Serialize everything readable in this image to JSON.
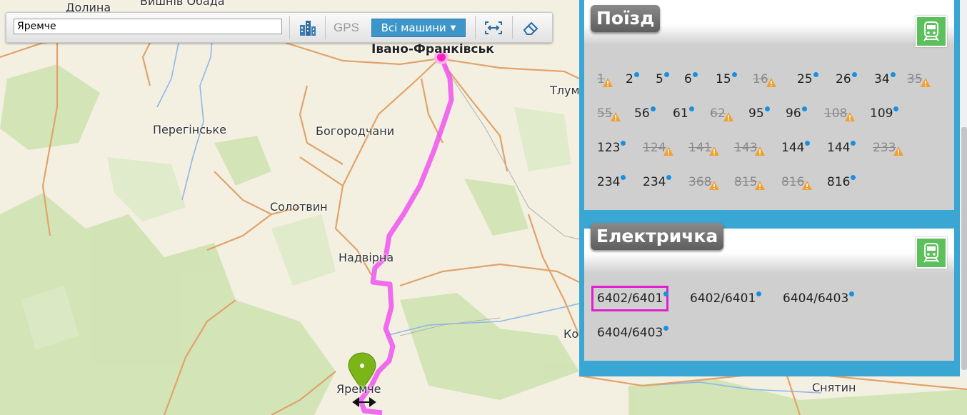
{
  "toolbar": {
    "search_value": "Яремче",
    "gps_label": "GPS",
    "machines_label": "Всі машини"
  },
  "map": {
    "labels": {
      "dolyna": "Долина",
      "vyshniv": "Вишнів Обада",
      "ivano": "Івано-Франківськ",
      "tlum": "Тлум",
      "perehinske": "Перегінське",
      "bohorodchany": "Богородчани",
      "solotvyn": "Солотвин",
      "nadvirna": "Надвірна",
      "yaremche": "Яремче",
      "ko": "Ко",
      "sniatyn": "Снятин"
    }
  },
  "panel": {
    "train": {
      "title": "Поїзд",
      "rows": [
        [
          {
            "num": "1",
            "ok": false
          },
          {
            "num": "2",
            "ok": true
          },
          {
            "num": "5",
            "ok": true
          },
          {
            "num": "6",
            "ok": true
          },
          {
            "num": "15",
            "ok": true
          },
          {
            "num": "16",
            "ok": false
          },
          {
            "num": "25",
            "ok": true
          },
          {
            "num": "26",
            "ok": true
          },
          {
            "num": "34",
            "ok": true
          },
          {
            "num": "35",
            "ok": false
          }
        ],
        [
          {
            "num": "55",
            "ok": false
          },
          {
            "num": "56",
            "ok": true
          },
          {
            "num": "61",
            "ok": true
          },
          {
            "num": "62",
            "ok": false
          },
          {
            "num": "95",
            "ok": true
          },
          {
            "num": "96",
            "ok": true
          },
          {
            "num": "108",
            "ok": false
          },
          {
            "num": "109",
            "ok": true
          }
        ],
        [
          {
            "num": "123",
            "ok": true
          },
          {
            "num": "124",
            "ok": false
          },
          {
            "num": "141",
            "ok": false
          },
          {
            "num": "143",
            "ok": false
          },
          {
            "num": "144",
            "ok": true
          },
          {
            "num": "144",
            "ok": true
          },
          {
            "num": "233",
            "ok": false
          }
        ],
        [
          {
            "num": "234",
            "ok": true
          },
          {
            "num": "234",
            "ok": true
          },
          {
            "num": "368",
            "ok": false
          },
          {
            "num": "815",
            "ok": false
          },
          {
            "num": "816",
            "ok": false
          },
          {
            "num": "816",
            "ok": true
          }
        ]
      ]
    },
    "elektrychka": {
      "title": "Електричка",
      "items": [
        {
          "num": "6402/6401",
          "ok": true,
          "selected": true
        },
        {
          "num": "6402/6401",
          "ok": true
        },
        {
          "num": "6404/6403",
          "ok": true
        },
        {
          "num": "6404/6403",
          "ok": true
        }
      ]
    }
  },
  "colors": {
    "route_line": "#ee55ee",
    "panel_frame": "#3aa6d3",
    "status_dot": "#1a8fe0",
    "warning": "#f0a030",
    "train_badge": "#5cc05c",
    "selection": "#e020d0",
    "marker": "#7cb518"
  }
}
